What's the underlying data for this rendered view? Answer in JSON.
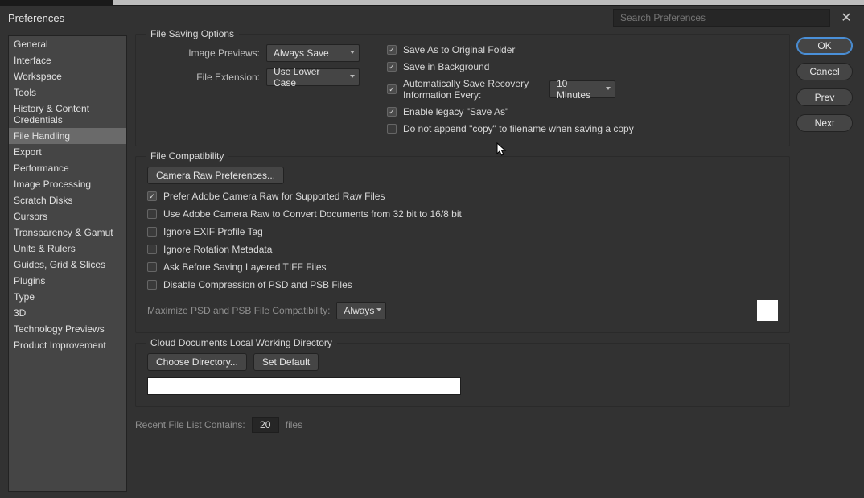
{
  "window": {
    "title": "Preferences",
    "search_placeholder": "Search Preferences"
  },
  "sidebar": {
    "items": [
      "General",
      "Interface",
      "Workspace",
      "Tools",
      "History & Content Credentials",
      "File Handling",
      "Export",
      "Performance",
      "Image Processing",
      "Scratch Disks",
      "Cursors",
      "Transparency & Gamut",
      "Units & Rulers",
      "Guides, Grid & Slices",
      "Plugins",
      "Type",
      "3D",
      "Technology Previews",
      "Product Improvement"
    ],
    "selected": "File Handling"
  },
  "buttons": {
    "ok": "OK",
    "cancel": "Cancel",
    "prev": "Prev",
    "next": "Next"
  },
  "file_saving": {
    "title": "File Saving Options",
    "image_previews_label": "Image Previews:",
    "image_previews_value": "Always Save",
    "file_extension_label": "File Extension:",
    "file_extension_value": "Use Lower Case",
    "save_as_original": "Save As to Original Folder",
    "save_in_background": "Save in Background",
    "auto_save_recovery": "Automatically Save Recovery Information Every:",
    "auto_save_interval": "10 Minutes",
    "enable_legacy_saveas": "Enable legacy \"Save As\"",
    "do_not_append_copy": "Do not append \"copy\" to filename when saving a copy"
  },
  "file_compat": {
    "title": "File Compatibility",
    "camera_raw_btn": "Camera Raw Preferences...",
    "prefer_acr": "Prefer Adobe Camera Raw for Supported Raw Files",
    "use_acr_convert": "Use Adobe Camera Raw to Convert Documents from 32 bit to 16/8 bit",
    "ignore_exif": "Ignore EXIF Profile Tag",
    "ignore_rotation": "Ignore Rotation Metadata",
    "ask_tiff": "Ask Before Saving Layered TIFF Files",
    "disable_compression": "Disable Compression of PSD and PSB Files",
    "max_psd_label": "Maximize PSD and PSB File Compatibility:",
    "max_psd_value": "Always"
  },
  "cloud_docs": {
    "title": "Cloud Documents Local Working Directory",
    "choose_btn": "Choose Directory...",
    "set_default_btn": "Set Default"
  },
  "recent": {
    "label": "Recent File List Contains:",
    "value": "20",
    "suffix": "files"
  }
}
